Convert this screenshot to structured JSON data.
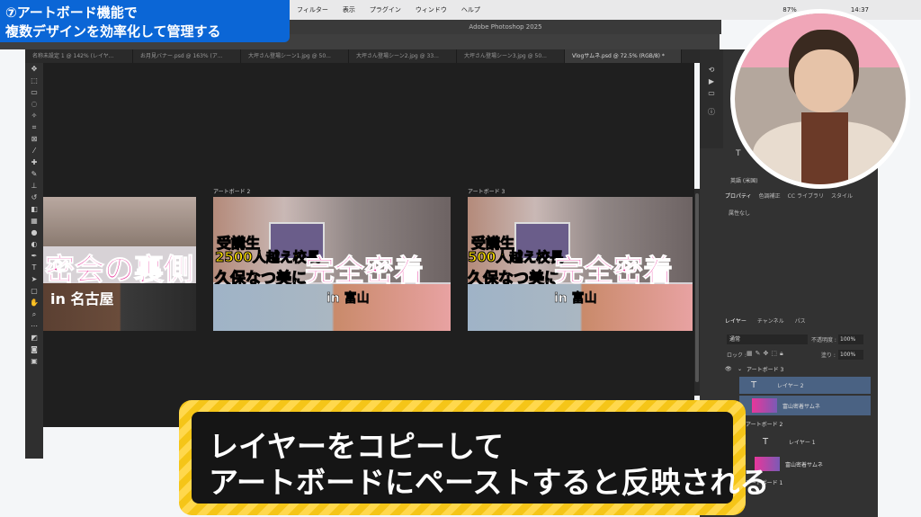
{
  "badge": {
    "line1": "⑦アートボード機能で",
    "line2": "複数デザインを効率化して管理する"
  },
  "menubar": {
    "items": [
      "フィルター",
      "表示",
      "プラグイン",
      "ウィンドウ",
      "ヘルプ"
    ],
    "battery": "87%",
    "time": "14:37"
  },
  "app": {
    "title": "Adobe Photoshop 2025"
  },
  "tabs": [
    "名称未設定 1 @ 142% (レイヤ...",
    "お月見バナー.psd @ 163% (ア...",
    "大坪さん登場シーン1.jpg @ 50...",
    "大坪さん登場シーン2.jpg @ 33...",
    "大坪さん登場シーン3.jpg @ 50...",
    "Vlogサムネ.psd @ 72.5% (RGB/8) *"
  ],
  "artboards": [
    {
      "label": "",
      "heading": "密会の裏側",
      "place": "in 名古屋"
    },
    {
      "label": "アートボード 2",
      "line1": "受講生",
      "line2": "2500人越え校長",
      "line3": "久保なつ美に",
      "heading": "完全密着",
      "place": "in 富山"
    },
    {
      "label": "アートボード 3",
      "line1": "受講生",
      "line2": "500人越え校長",
      "line3": "久保なつ美に",
      "heading": "完全密着",
      "place": "in 富山"
    }
  ],
  "panels": {
    "tabs": [
      "プロパティ",
      "色調補正",
      "CC ライブラリ",
      "スタイル"
    ],
    "properties_text": "属性なし",
    "font_label": "英語 (米国)",
    "layer_tabs": [
      "レイヤー",
      "チャンネル",
      "パス"
    ],
    "blend_mode": "通常",
    "opacity_label": "不透明度 :",
    "opacity": "100%",
    "lock_label": "ロック :",
    "fill_label": "塗り :",
    "fill": "100%",
    "layers": [
      {
        "name": "アートボード 3",
        "kind": "group"
      },
      {
        "name": "レイヤー 2",
        "kind": "text"
      },
      {
        "name": "富山密着サムネ",
        "kind": "image"
      },
      {
        "name": "アートボード 2",
        "kind": "group"
      },
      {
        "name": "レイヤー 1",
        "kind": "text"
      },
      {
        "name": "富山密着サムネ",
        "kind": "image"
      },
      {
        "name": "アートボード 1",
        "kind": "group"
      }
    ]
  },
  "caption": {
    "line1": "レイヤーをコピーして",
    "line2": "アートボードにペーストすると反映される"
  },
  "colors": {
    "accent": "#0b66d6",
    "caption_border": "#f5c518",
    "heading_pink": "#e8379b"
  }
}
